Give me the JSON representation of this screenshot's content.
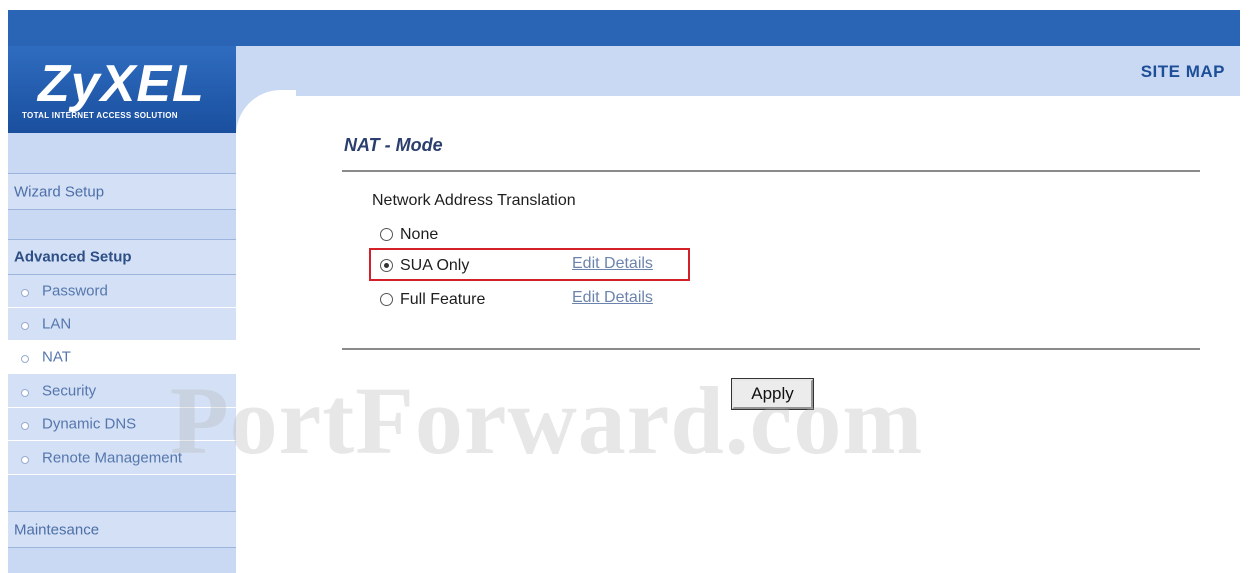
{
  "header": {
    "brand": "ZyXEL",
    "tagline": "TOTAL INTERNET ACCESS SOLUTION",
    "site_map": "SITE MAP"
  },
  "sidebar": {
    "wizard": "Wizard Setup",
    "advanced": "Advanced Setup",
    "items": [
      {
        "label": "Password",
        "active": false
      },
      {
        "label": "LAN",
        "active": false
      },
      {
        "label": "NAT",
        "active": true
      },
      {
        "label": "Security",
        "active": false
      },
      {
        "label": "Dynamic DNS",
        "active": false
      },
      {
        "label": "Renote Management",
        "active": false
      }
    ],
    "maintenance": "Maintesance"
  },
  "main": {
    "title": "NAT - Mode",
    "section_label": "Network Address Translation",
    "options": [
      {
        "label": "None",
        "checked": false,
        "edit_link": ""
      },
      {
        "label": "SUA Only",
        "checked": true,
        "edit_link": "Edit Details"
      },
      {
        "label": "Full Feature",
        "checked": false,
        "edit_link": "Edit Details"
      }
    ],
    "apply_label": "Apply"
  },
  "watermark": "PortForward.com",
  "colors": {
    "header_blue": "#2a64b4",
    "sidebar_band": "#c9d9f3",
    "highlight_red": "#d42028"
  }
}
